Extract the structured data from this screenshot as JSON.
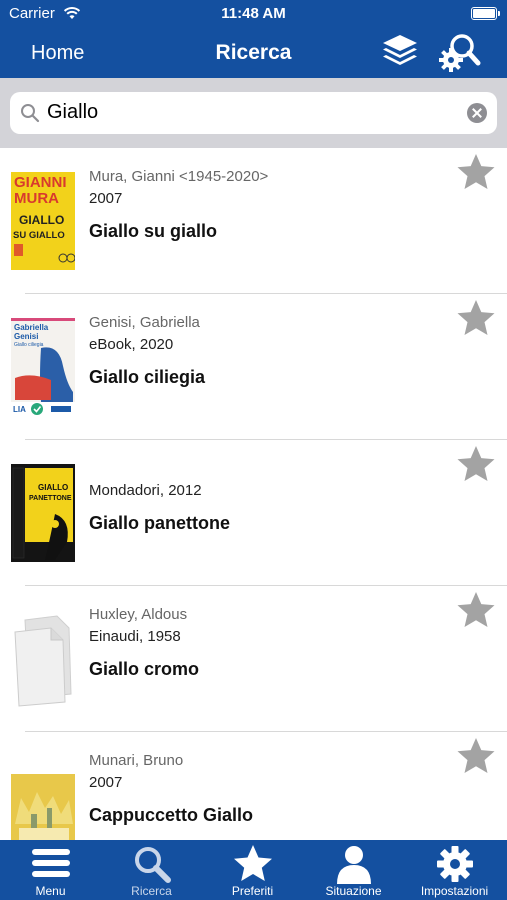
{
  "status": {
    "carrier": "Carrier",
    "time": "11:48 AM"
  },
  "nav": {
    "back_label": "Home",
    "title": "Ricerca"
  },
  "search": {
    "query": "Giallo"
  },
  "results": [
    {
      "author": "Mura, Gianni <1945-2020>",
      "pub": "2007",
      "title": "Giallo su giallo",
      "cover": "giallo-su-giallo"
    },
    {
      "author": "Genisi, Gabriella",
      "pub": "eBook, 2020",
      "title": "Giallo ciliegia",
      "cover": "giallo-ciliegia"
    },
    {
      "author": "",
      "pub": "Mondadori, 2012",
      "title": "Giallo panettone",
      "cover": "giallo-panettone"
    },
    {
      "author": "Huxley, Aldous",
      "pub": "Einaudi, 1958",
      "title": "Giallo cromo",
      "cover": "placeholder"
    },
    {
      "author": "Munari, Bruno",
      "pub": "2007",
      "title": "Cappuccetto Giallo",
      "cover": "cappuccetto-giallo"
    }
  ],
  "cover_text": {
    "r0_line1": "GIANNI",
    "r0_line2": "MURA",
    "r0_line3": "GIALLO",
    "r0_line4": "SU GIALLO",
    "r1_line1": "Gabriella",
    "r1_line2": "Genisi",
    "r1_line3": "Giallo ciliegia",
    "r1_badge": "LIA",
    "r2_line1": "GIALLO",
    "r2_line2": "PANETTONE"
  },
  "tabs": [
    {
      "label": "Menu",
      "icon": "menu-icon"
    },
    {
      "label": "Ricerca",
      "icon": "search-icon",
      "active": true
    },
    {
      "label": "Preferiti",
      "icon": "star-icon"
    },
    {
      "label": "Situazione",
      "icon": "person-icon"
    },
    {
      "label": "Impostazioni",
      "icon": "gear-icon"
    }
  ],
  "colors": {
    "bar": "#1450a0",
    "star": "#a3a3a3",
    "search_bg": "#d3d3d8"
  }
}
